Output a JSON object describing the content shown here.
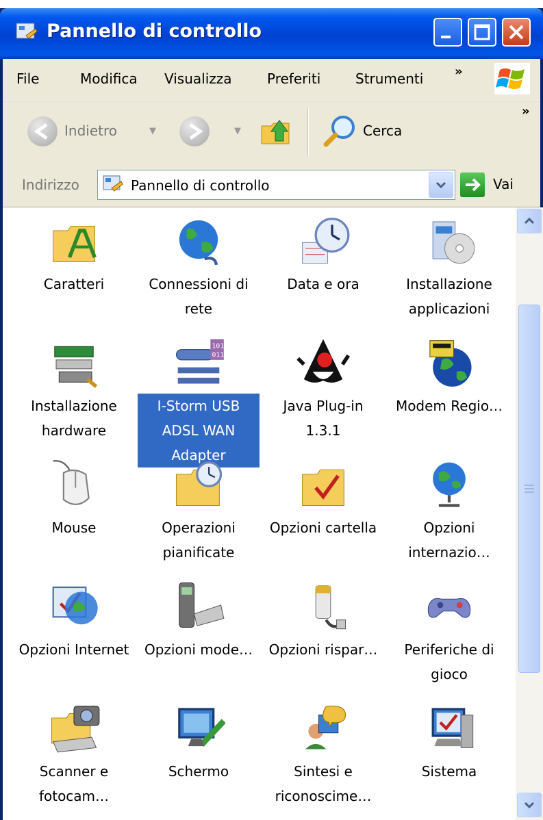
{
  "window": {
    "title": "Pannello di controllo"
  },
  "menu": [
    "File",
    "Modifica",
    "Visualizza",
    "Preferiti",
    "Strumenti"
  ],
  "menu_more": "»",
  "toolbar": {
    "back": "Indietro",
    "search": "Cerca",
    "more": "»"
  },
  "address": {
    "label": "Indirizzo",
    "value": "Pannello di controllo",
    "go": "Vai"
  },
  "items": [
    {
      "label": "Caratteri",
      "icon": "fonts-folder-icon"
    },
    {
      "label": "Connessioni di rete",
      "icon": "network-connections-icon"
    },
    {
      "label": "Data e ora",
      "icon": "date-time-icon"
    },
    {
      "label": "Installazione applicazioni",
      "icon": "add-remove-programs-icon"
    },
    {
      "label": "Installazione hardware",
      "icon": "add-hardware-icon"
    },
    {
      "label": "I-Storm USB ADSL WAN Adapter",
      "icon": "adsl-adapter-icon",
      "selected": true
    },
    {
      "label": "Java Plug-in 1.3.1",
      "icon": "java-duke-icon"
    },
    {
      "label": "Modem Regio…",
      "icon": "modem-globe-icon"
    },
    {
      "label": "Mouse",
      "icon": "mouse-icon"
    },
    {
      "label": "Operazioni pianificate",
      "icon": "scheduled-tasks-icon"
    },
    {
      "label": "Opzioni cartella",
      "icon": "folder-options-icon"
    },
    {
      "label": "Opzioni internazio…",
      "icon": "regional-globe-icon"
    },
    {
      "label": "Opzioni Internet",
      "icon": "internet-options-icon"
    },
    {
      "label": "Opzioni mode…",
      "icon": "phone-modem-icon"
    },
    {
      "label": "Opzioni rispar…",
      "icon": "power-options-icon"
    },
    {
      "label": "Periferiche di gioco",
      "icon": "game-controller-icon"
    },
    {
      "label": "Scanner e fotocam…",
      "icon": "scanner-camera-icon"
    },
    {
      "label": "Schermo",
      "icon": "display-icon"
    },
    {
      "label": "Sintesi e riconoscime…",
      "icon": "speech-icon"
    },
    {
      "label": "Sistema",
      "icon": "system-icon"
    }
  ],
  "colors": {
    "titlebar": "#0054e3",
    "selection": "#316ac5",
    "close_button": "#c63a18"
  }
}
